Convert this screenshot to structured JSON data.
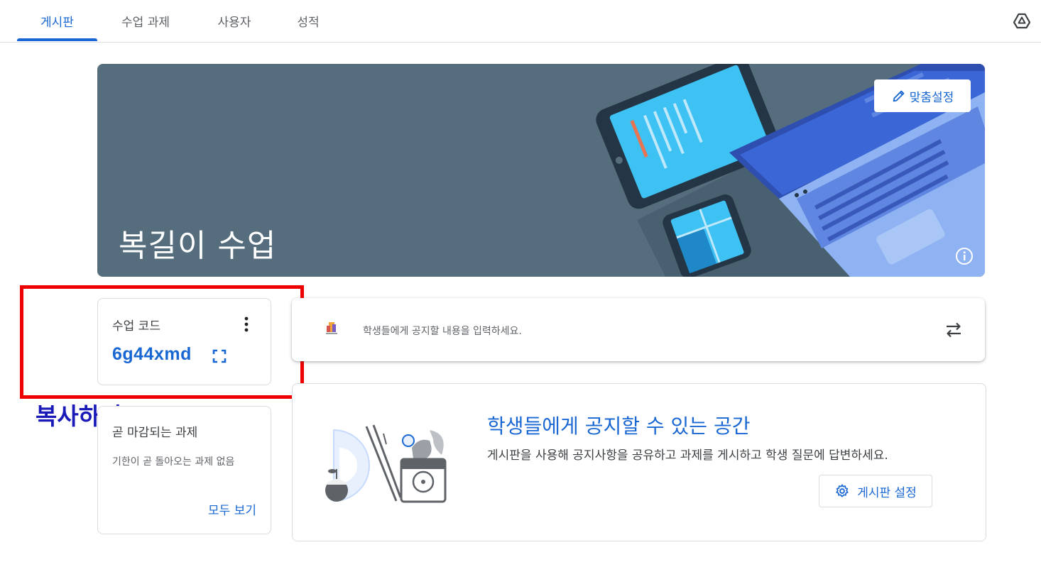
{
  "tabs": [
    {
      "label": "게시판",
      "active": true
    },
    {
      "label": "수업 과제",
      "active": false
    },
    {
      "label": "사용자",
      "active": false
    },
    {
      "label": "성적",
      "active": false
    }
  ],
  "header": {
    "drive_icon": "google-drive-icon"
  },
  "banner": {
    "title": "복길이 수업",
    "customize_label": "맞춤설정",
    "background_color": "#566d7d"
  },
  "class_code": {
    "label": "수업 코드",
    "value": "6g44xmd"
  },
  "annotation": {
    "label": "복사하기",
    "box_color": "#ee0000",
    "text_color": "#1a1ab8"
  },
  "upcoming": {
    "title": "곧 마감되는 과제",
    "empty_text": "기한이 곧 돌아오는 과제 없음",
    "view_all_label": "모두 보기"
  },
  "announce": {
    "placeholder": "학생들에게 공지할 내용을 입력하세요."
  },
  "stream_info": {
    "title": "학생들에게 공지할 수 있는 공간",
    "description": "게시판을 사용해 공지사항을 공유하고 과제를 게시하고 학생 질문에 답변하세요.",
    "settings_label": "게시판 설정"
  },
  "colors": {
    "accent": "#1967d2",
    "text": "#3c4043",
    "muted": "#5f6368",
    "border": "#dadce0"
  }
}
